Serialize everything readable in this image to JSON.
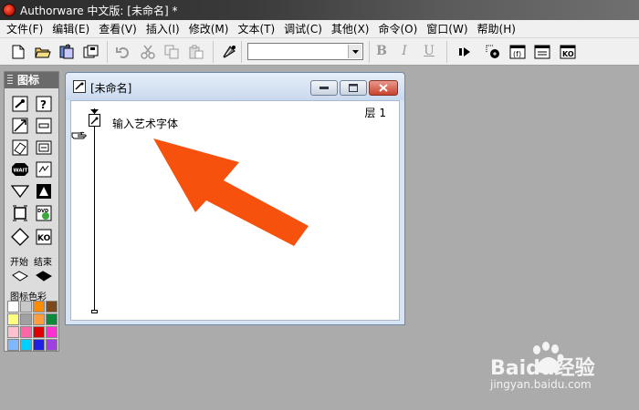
{
  "window": {
    "title": "Authorware 中文版: [未命名] *"
  },
  "menu": [
    "文件(F)",
    "编辑(E)",
    "查看(V)",
    "插入(I)",
    "修改(M)",
    "文本(T)",
    "调试(C)",
    "其他(X)",
    "命令(O)",
    "窗口(W)",
    "帮助(H)"
  ],
  "toolbar": {
    "font_value": "",
    "bold_label": "B",
    "italic_label": "I",
    "underline_label": "U"
  },
  "palette": {
    "title": "图标",
    "start_label": "开始",
    "end_label": "结束",
    "color_title": "图标色彩",
    "colors": [
      "#ffffff",
      "#c8c8c8",
      "#ff8c00",
      "#7a4a1a",
      "#ffff80",
      "#a0a0a0",
      "#ff9c3c",
      "#0a8a3a",
      "#ffc0d0",
      "#ff66a8",
      "#e00000",
      "#ff2fd0",
      "#7fb8ff",
      "#00d0ff",
      "#2020e0",
      "#a040e0"
    ]
  },
  "flow_window": {
    "title": "[未命名]",
    "layer_label": "层 1",
    "icon_label": "输入艺术字体"
  },
  "watermark": {
    "logo": "Baidu经验",
    "site": "jingyan.baidu.com"
  },
  "colors": {
    "arrow": "#f7510e",
    "title_bar": "#333333"
  }
}
